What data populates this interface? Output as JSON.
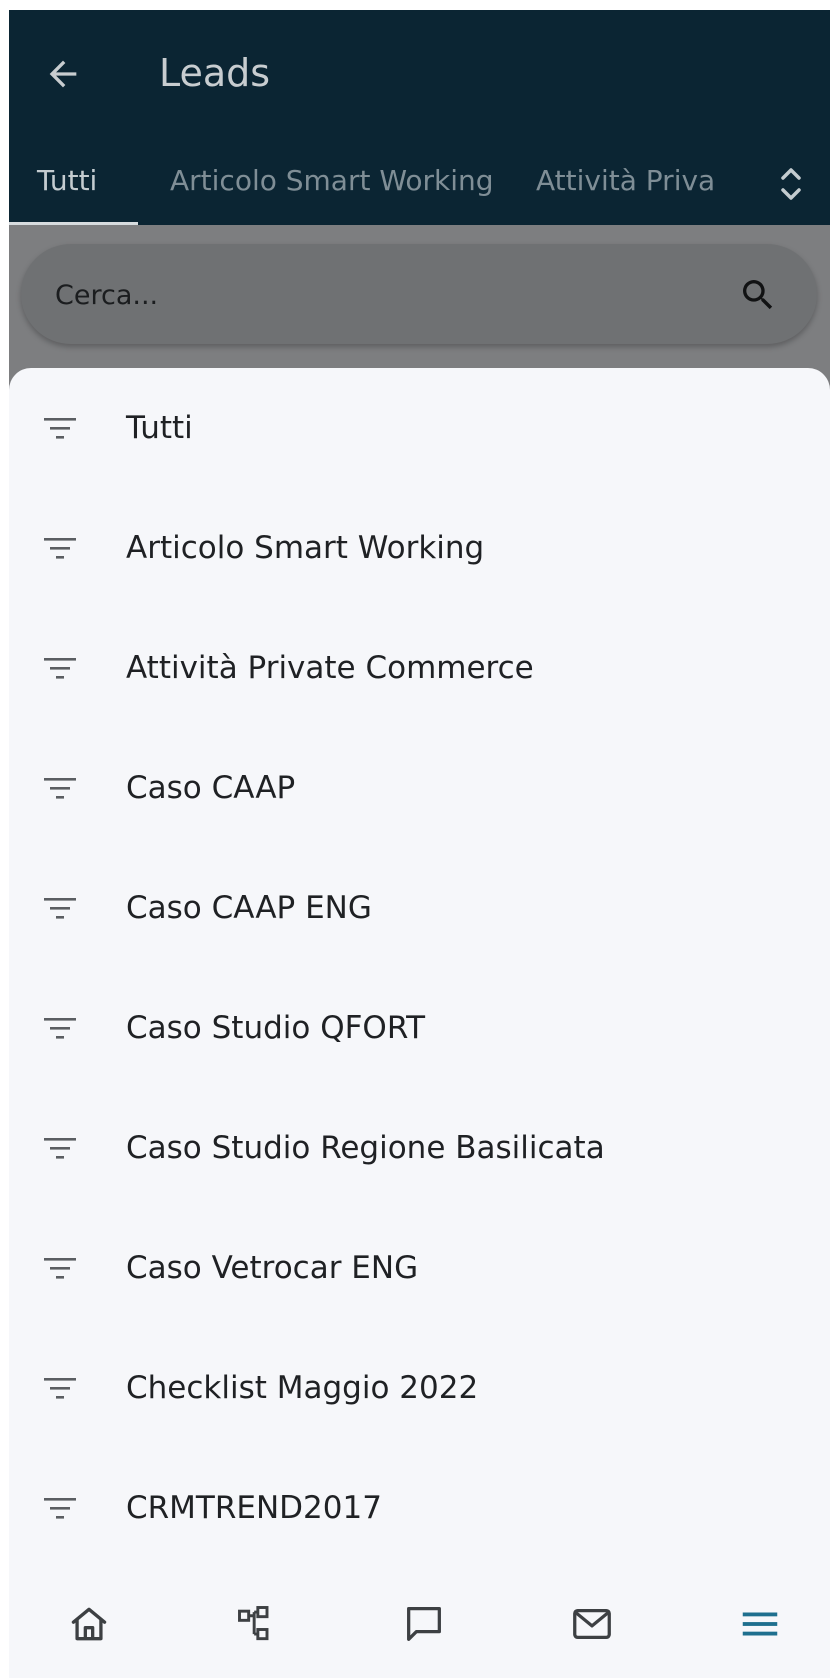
{
  "app": {
    "title": "Leads",
    "back_icon": "arrow-left-icon"
  },
  "tabs": [
    {
      "label": "Tutti",
      "active": true
    },
    {
      "label": "Articolo Smart Working",
      "active": false
    },
    {
      "label": "Attività Priva",
      "active": false
    }
  ],
  "tabs_scroll_icon": "chevron-up-down-icon",
  "search": {
    "placeholder": "Cerca...",
    "icon": "search-icon"
  },
  "filters": [
    {
      "label": "Tutti",
      "icon": "filter-icon"
    },
    {
      "label": "Articolo Smart Working",
      "icon": "filter-icon"
    },
    {
      "label": "Attività Private Commerce",
      "icon": "filter-icon"
    },
    {
      "label": "Caso CAAP",
      "icon": "filter-icon"
    },
    {
      "label": "Caso CAAP ENG",
      "icon": "filter-icon"
    },
    {
      "label": "Caso Studio QFORT",
      "icon": "filter-icon"
    },
    {
      "label": "Caso Studio Regione Basilicata",
      "icon": "filter-icon"
    },
    {
      "label": "Caso Vetrocar ENG",
      "icon": "filter-icon"
    },
    {
      "label": "Checklist Maggio 2022",
      "icon": "filter-icon"
    },
    {
      "label": "CRMTREND2017",
      "icon": "filter-icon"
    }
  ],
  "bottom_nav": [
    {
      "icon": "home-icon"
    },
    {
      "icon": "hierarchy-icon"
    },
    {
      "icon": "chat-icon"
    },
    {
      "icon": "mail-icon"
    },
    {
      "icon": "menu-icon",
      "active": true
    }
  ],
  "colors": {
    "header_bg": "#0b2533",
    "sheet_bg": "#f6f7fa",
    "icon_default": "#3d4043",
    "icon_active": "#1e6f8e"
  }
}
